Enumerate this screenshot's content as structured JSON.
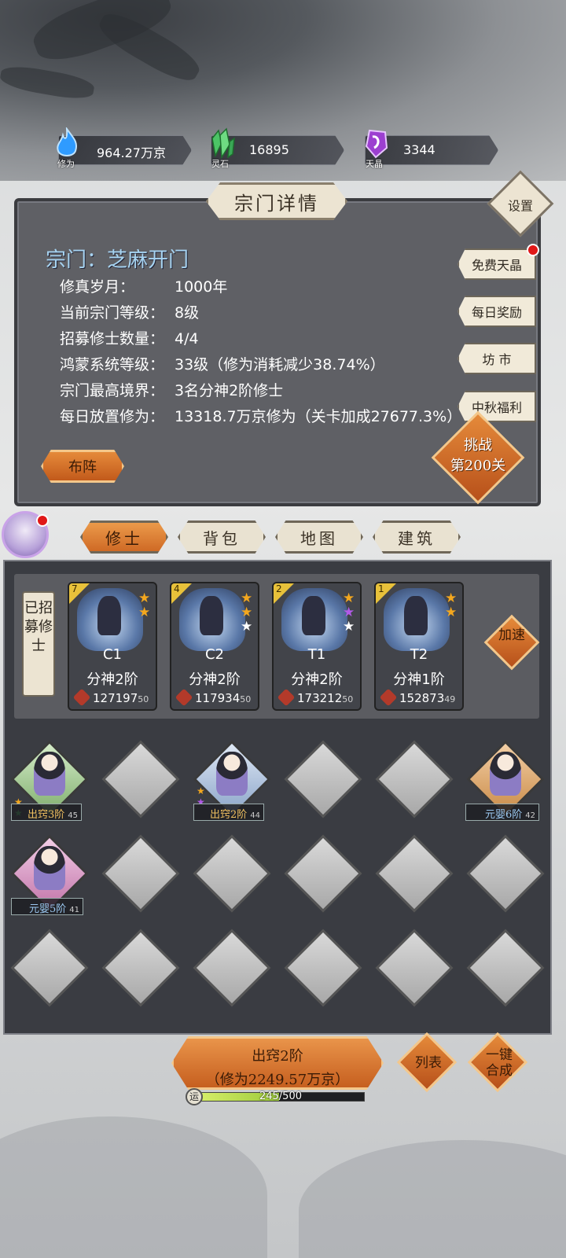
{
  "resources": [
    {
      "name": "修为",
      "value": "964.27万京",
      "icon": "blue-flame-icon",
      "color": "#3aa8ff"
    },
    {
      "name": "灵石",
      "value": "16895",
      "icon": "green-crystal-icon",
      "color": "#4cc466"
    },
    {
      "name": "天晶",
      "value": "3344",
      "icon": "purple-gem-icon",
      "color": "#a64cd6"
    }
  ],
  "panel": {
    "title": "宗门详情",
    "settings_label": "设置",
    "sect_name": "宗门：芝麻开门",
    "info": [
      {
        "key": "修真岁月：",
        "value": "1000年"
      },
      {
        "key": "当前宗门等级：",
        "value": "8级"
      },
      {
        "key": "招募修士数量：",
        "value": "4/4"
      },
      {
        "key": "鸿蒙系统等级：",
        "value": "33级（修为消耗减少38.74%）"
      },
      {
        "key": "宗门最高境界：",
        "value": "3名分神2阶修士"
      },
      {
        "key": "每日放置修为：",
        "value": "13318.7万京修为（关卡加成27677.3%）"
      }
    ],
    "side_buttons": [
      "免费天晶",
      "每日奖励",
      "坊 市",
      "中秋福利"
    ],
    "formation_label": "布阵",
    "challenge_line1": "挑战",
    "challenge_line2": "第200关"
  },
  "tabs": [
    "修士",
    "背包",
    "地图",
    "建筑"
  ],
  "recruited_label": "已招募修士",
  "speed_label": "加速",
  "cards": [
    {
      "rank": "7",
      "name": "C1",
      "realm": "分神2阶",
      "power": "127197",
      "level": "50",
      "stars": [
        "★",
        "★"
      ],
      "star_colors": [
        "#f3a71e",
        "#f3a71e"
      ]
    },
    {
      "rank": "4",
      "name": "C2",
      "realm": "分神2阶",
      "power": "117934",
      "level": "50",
      "stars": [
        "★",
        "★",
        "★"
      ],
      "star_colors": [
        "#f3a71e",
        "#f3a71e",
        "#ffffff"
      ]
    },
    {
      "rank": "2",
      "name": "T1",
      "realm": "分神2阶",
      "power": "173212",
      "level": "50",
      "stars": [
        "★",
        "★",
        "★"
      ],
      "star_colors": [
        "#f3a71e",
        "#b25ae8",
        "#ffffff"
      ]
    },
    {
      "rank": "1",
      "name": "T2",
      "realm": "分神1阶",
      "power": "152873",
      "level": "49",
      "stars": [
        "★",
        "★"
      ],
      "star_colors": [
        "#f3a71e",
        "#f3a71e"
      ]
    }
  ],
  "slots": [
    {
      "label": "出窍3阶",
      "level": "45",
      "variant": "green"
    },
    {
      "label": "出窍2阶",
      "level": "44",
      "variant": "blue"
    },
    {
      "label": "元婴6阶",
      "level": "42",
      "variant": "orange"
    },
    {
      "label": "元婴5阶",
      "level": "41",
      "variant": "pink"
    }
  ],
  "bottom": {
    "break_line1": "出窍2阶",
    "break_line2": "（修为2249.57万京）",
    "list_label": "列表",
    "merge_line1": "一键",
    "merge_line2": "合成",
    "luck_icon_text": "运",
    "luck_text": "245/500",
    "luck_progress": 0.49
  }
}
